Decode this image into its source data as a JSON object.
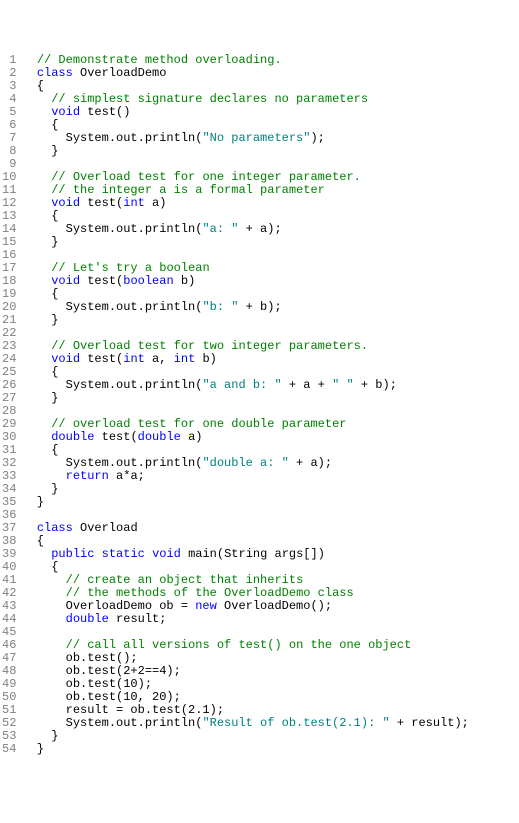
{
  "lines": [
    {
      "n": 1,
      "tokens": [
        [
          "  ",
          "p"
        ],
        [
          "// Demonstrate method overloading.",
          "comment"
        ]
      ]
    },
    {
      "n": 2,
      "tokens": [
        [
          "  ",
          "p"
        ],
        [
          "class",
          "keyword"
        ],
        [
          " ",
          "p"
        ],
        [
          "OverloadDemo",
          "ident"
        ]
      ]
    },
    {
      "n": 3,
      "tokens": [
        [
          "  {",
          "p"
        ]
      ]
    },
    {
      "n": 4,
      "tokens": [
        [
          "    ",
          "p"
        ],
        [
          "// simplest signature declares no parameters",
          "comment"
        ]
      ]
    },
    {
      "n": 5,
      "tokens": [
        [
          "    ",
          "p"
        ],
        [
          "void",
          "type"
        ],
        [
          " ",
          "p"
        ],
        [
          "test",
          "ident"
        ],
        [
          "()",
          "p"
        ]
      ]
    },
    {
      "n": 6,
      "tokens": [
        [
          "    {",
          "p"
        ]
      ]
    },
    {
      "n": 7,
      "tokens": [
        [
          "      System.out.println(",
          "p"
        ],
        [
          "\"No parameters\"",
          "string"
        ],
        [
          ");",
          "p"
        ]
      ]
    },
    {
      "n": 8,
      "tokens": [
        [
          "    }",
          "p"
        ]
      ]
    },
    {
      "n": 9,
      "tokens": [
        [
          "",
          "p"
        ]
      ]
    },
    {
      "n": 10,
      "tokens": [
        [
          "    ",
          "p"
        ],
        [
          "// Overload test for one integer parameter.",
          "comment"
        ]
      ]
    },
    {
      "n": 11,
      "tokens": [
        [
          "    ",
          "p"
        ],
        [
          "// the integer a is a formal parameter",
          "comment"
        ]
      ]
    },
    {
      "n": 12,
      "tokens": [
        [
          "    ",
          "p"
        ],
        [
          "void",
          "type"
        ],
        [
          " ",
          "p"
        ],
        [
          "test",
          "ident"
        ],
        [
          "(",
          "p"
        ],
        [
          "int",
          "type"
        ],
        [
          " a)",
          "p"
        ]
      ]
    },
    {
      "n": 13,
      "tokens": [
        [
          "    {",
          "p"
        ]
      ]
    },
    {
      "n": 14,
      "tokens": [
        [
          "      System.out.println(",
          "p"
        ],
        [
          "\"a: \"",
          "string"
        ],
        [
          " + a);",
          "p"
        ]
      ]
    },
    {
      "n": 15,
      "tokens": [
        [
          "    }",
          "p"
        ]
      ]
    },
    {
      "n": 16,
      "tokens": [
        [
          "",
          "p"
        ]
      ]
    },
    {
      "n": 17,
      "tokens": [
        [
          "    ",
          "p"
        ],
        [
          "// Let's try a boolean",
          "comment"
        ]
      ]
    },
    {
      "n": 18,
      "tokens": [
        [
          "    ",
          "p"
        ],
        [
          "void",
          "type"
        ],
        [
          " ",
          "p"
        ],
        [
          "test",
          "ident"
        ],
        [
          "(",
          "p"
        ],
        [
          "boolean",
          "type"
        ],
        [
          " b)",
          "p"
        ]
      ]
    },
    {
      "n": 19,
      "tokens": [
        [
          "    {",
          "p"
        ]
      ]
    },
    {
      "n": 20,
      "tokens": [
        [
          "      System.out.println(",
          "p"
        ],
        [
          "\"b: \"",
          "string"
        ],
        [
          " + b);",
          "p"
        ]
      ]
    },
    {
      "n": 21,
      "tokens": [
        [
          "    }",
          "p"
        ]
      ]
    },
    {
      "n": 22,
      "tokens": [
        [
          "",
          "p"
        ]
      ]
    },
    {
      "n": 23,
      "tokens": [
        [
          "    ",
          "p"
        ],
        [
          "// Overload test for two integer parameters.",
          "comment"
        ]
      ]
    },
    {
      "n": 24,
      "tokens": [
        [
          "    ",
          "p"
        ],
        [
          "void",
          "type"
        ],
        [
          " ",
          "p"
        ],
        [
          "test",
          "ident"
        ],
        [
          "(",
          "p"
        ],
        [
          "int",
          "type"
        ],
        [
          " a, ",
          "p"
        ],
        [
          "int",
          "type"
        ],
        [
          " b)",
          "p"
        ]
      ]
    },
    {
      "n": 25,
      "tokens": [
        [
          "    {",
          "p"
        ]
      ]
    },
    {
      "n": 26,
      "tokens": [
        [
          "      System.out.println(",
          "p"
        ],
        [
          "\"a and b: \"",
          "string"
        ],
        [
          " + a + ",
          "p"
        ],
        [
          "\" \"",
          "string"
        ],
        [
          " + b);",
          "p"
        ]
      ]
    },
    {
      "n": 27,
      "tokens": [
        [
          "    }",
          "p"
        ]
      ]
    },
    {
      "n": 28,
      "tokens": [
        [
          "",
          "p"
        ]
      ]
    },
    {
      "n": 29,
      "tokens": [
        [
          "    ",
          "p"
        ],
        [
          "// overload test for one double parameter",
          "comment"
        ]
      ]
    },
    {
      "n": 30,
      "tokens": [
        [
          "    ",
          "p"
        ],
        [
          "double",
          "type"
        ],
        [
          " ",
          "p"
        ],
        [
          "test",
          "ident"
        ],
        [
          "(",
          "p"
        ],
        [
          "double",
          "type"
        ],
        [
          " a)",
          "p"
        ]
      ]
    },
    {
      "n": 31,
      "tokens": [
        [
          "    {",
          "p"
        ]
      ]
    },
    {
      "n": 32,
      "tokens": [
        [
          "      System.out.println(",
          "p"
        ],
        [
          "\"double a: \"",
          "string"
        ],
        [
          " + a);",
          "p"
        ]
      ]
    },
    {
      "n": 33,
      "tokens": [
        [
          "      ",
          "p"
        ],
        [
          "return",
          "keyword"
        ],
        [
          " a*a;",
          "p"
        ]
      ]
    },
    {
      "n": 34,
      "tokens": [
        [
          "    }",
          "p"
        ]
      ]
    },
    {
      "n": 35,
      "tokens": [
        [
          "  }",
          "p"
        ]
      ]
    },
    {
      "n": 36,
      "tokens": [
        [
          "",
          "p"
        ]
      ]
    },
    {
      "n": 37,
      "tokens": [
        [
          "  ",
          "p"
        ],
        [
          "class",
          "keyword"
        ],
        [
          " ",
          "p"
        ],
        [
          "Overload",
          "ident"
        ]
      ]
    },
    {
      "n": 38,
      "tokens": [
        [
          "  {",
          "p"
        ]
      ]
    },
    {
      "n": 39,
      "tokens": [
        [
          "    ",
          "p"
        ],
        [
          "public",
          "keyword"
        ],
        [
          " ",
          "p"
        ],
        [
          "static",
          "keyword"
        ],
        [
          " ",
          "p"
        ],
        [
          "void",
          "type"
        ],
        [
          " ",
          "p"
        ],
        [
          "main",
          "ident"
        ],
        [
          "(String args[])",
          "p"
        ]
      ]
    },
    {
      "n": 40,
      "tokens": [
        [
          "    {",
          "p"
        ]
      ]
    },
    {
      "n": 41,
      "tokens": [
        [
          "      ",
          "p"
        ],
        [
          "// create an object that inherits",
          "comment"
        ]
      ]
    },
    {
      "n": 42,
      "tokens": [
        [
          "      ",
          "p"
        ],
        [
          "// the methods of the OverloadDemo class",
          "comment"
        ]
      ]
    },
    {
      "n": 43,
      "tokens": [
        [
          "      OverloadDemo ob = ",
          "p"
        ],
        [
          "new",
          "keyword"
        ],
        [
          " OverloadDemo();",
          "p"
        ]
      ]
    },
    {
      "n": 44,
      "tokens": [
        [
          "      ",
          "p"
        ],
        [
          "double",
          "type"
        ],
        [
          " result;",
          "p"
        ]
      ]
    },
    {
      "n": 45,
      "tokens": [
        [
          "",
          "p"
        ]
      ]
    },
    {
      "n": 46,
      "tokens": [
        [
          "      ",
          "p"
        ],
        [
          "// call all versions of test() on the one object",
          "comment"
        ]
      ]
    },
    {
      "n": 47,
      "tokens": [
        [
          "      ob.test();",
          "p"
        ]
      ]
    },
    {
      "n": 48,
      "tokens": [
        [
          "      ob.test(2+2==4);",
          "p"
        ]
      ]
    },
    {
      "n": 49,
      "tokens": [
        [
          "      ob.test(10);",
          "p"
        ]
      ]
    },
    {
      "n": 50,
      "tokens": [
        [
          "      ob.test(10, 20);",
          "p"
        ]
      ]
    },
    {
      "n": 51,
      "tokens": [
        [
          "      result = ob.test(2.1);",
          "p"
        ]
      ]
    },
    {
      "n": 52,
      "tokens": [
        [
          "      System.out.println(",
          "p"
        ],
        [
          "\"Result of ob.test(2.1): \"",
          "string"
        ],
        [
          " + result);",
          "p"
        ]
      ]
    },
    {
      "n": 53,
      "tokens": [
        [
          "    }",
          "p"
        ]
      ]
    },
    {
      "n": 54,
      "tokens": [
        [
          "  }",
          "p"
        ]
      ]
    }
  ]
}
